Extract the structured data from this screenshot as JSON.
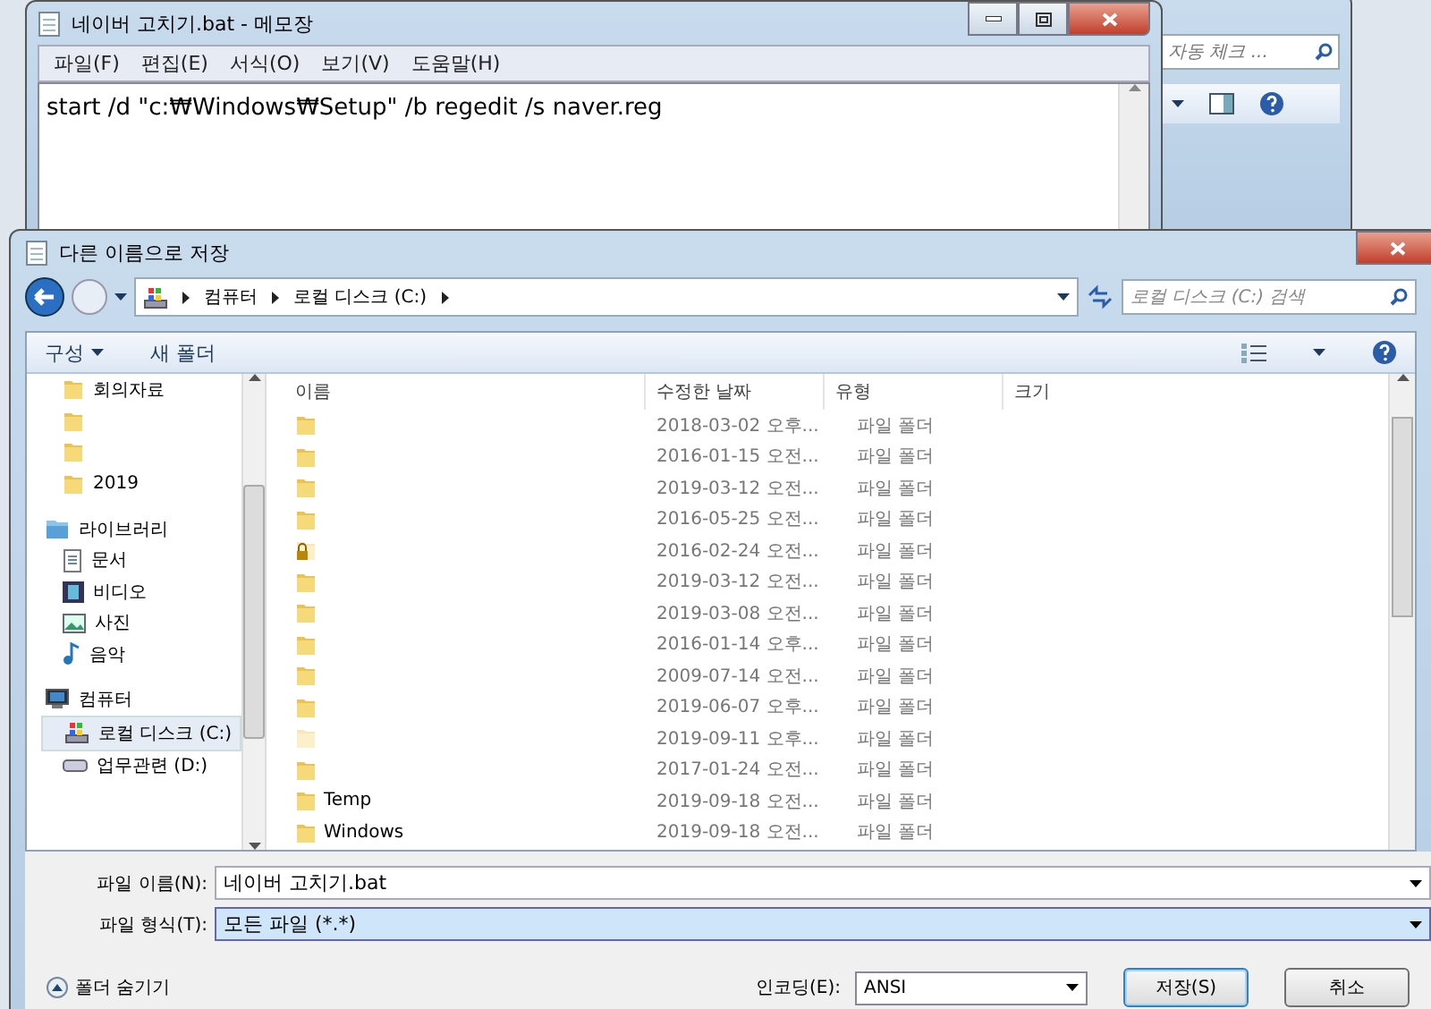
{
  "background_window": {
    "search": {
      "placeholder": "자동 체크 ..."
    }
  },
  "notepad": {
    "title": "네이버 고치기.bat - 메모장",
    "menu": [
      "파일(F)",
      "편집(E)",
      "서식(O)",
      "보기(V)",
      "도움말(H)"
    ],
    "text": "start /d \"c:₩Windows₩Setup\" /b regedit /s naver.reg"
  },
  "dialog": {
    "title": "다른 이름으로 저장",
    "breadcrumb": [
      "컴퓨터",
      "로컬 디스크 (C:)"
    ],
    "search": {
      "placeholder": "로컬 디스크 (C:) 검색"
    },
    "toolbar": {
      "organize": "구성",
      "new_folder": "새 폴더"
    },
    "nav": [
      {
        "kind": "folder",
        "label": "회의자료",
        "selected": false
      },
      {
        "kind": "folder",
        "selected": false
      },
      {
        "kind": "folder",
        "selected": false
      },
      {
        "kind": "folder",
        "label": "2019",
        "selected": false
      },
      {
        "kind": "library",
        "label": "라이브러리",
        "selected": false,
        "children": [
          {
            "kind": "document",
            "label": "문서",
            "selected": false
          },
          {
            "kind": "video",
            "label": "비디오",
            "selected": false
          },
          {
            "kind": "picture",
            "label": "사진",
            "selected": false
          },
          {
            "kind": "music",
            "label": "음악",
            "selected": false
          }
        ]
      },
      {
        "kind": "computer",
        "label": "컴퓨터",
        "selected": false,
        "children": [
          {
            "kind": "system-drive",
            "label": "로컬 디스크 (C:)",
            "selected": true
          },
          {
            "kind": "drive",
            "label": "업무관련 (D:)",
            "selected": false
          }
        ]
      }
    ],
    "columns": [
      "이름",
      "수정한 날짜",
      "유형",
      "크기"
    ],
    "rows": [
      {
        "kind": "folder",
        "date": "2018-03-02 오후...",
        "type": "파일 폴더"
      },
      {
        "kind": "folder",
        "date": "2016-01-15 오전...",
        "type": "파일 폴더"
      },
      {
        "kind": "folder",
        "date": "2019-03-12 오전...",
        "type": "파일 폴더"
      },
      {
        "kind": "folder",
        "date": "2016-05-25 오전...",
        "type": "파일 폴더"
      },
      {
        "kind": "locked",
        "date": "2016-02-24 오전...",
        "type": "파일 폴더"
      },
      {
        "kind": "folder",
        "date": "2019-03-12 오전...",
        "type": "파일 폴더"
      },
      {
        "kind": "folder",
        "date": "2019-03-08 오전...",
        "type": "파일 폴더"
      },
      {
        "kind": "folder",
        "date": "2016-01-14 오후...",
        "type": "파일 폴더"
      },
      {
        "kind": "folder",
        "date": "2009-07-14 오전...",
        "type": "파일 폴더"
      },
      {
        "kind": "folder",
        "date": "2019-06-07 오후...",
        "type": "파일 폴더"
      },
      {
        "kind": "hidden",
        "date": "2019-09-11 오후...",
        "type": "파일 폴더"
      },
      {
        "kind": "folder",
        "date": "2017-01-24 오전...",
        "type": "파일 폴더"
      },
      {
        "kind": "folder",
        "name": "Temp",
        "date": "2019-09-18 오전...",
        "type": "파일 폴더"
      },
      {
        "kind": "folder",
        "name": "Windows",
        "date": "2019-09-18 오전...",
        "type": "파일 폴더"
      }
    ],
    "file_name": {
      "label": "파일 이름(N):",
      "value": "네이버 고치기.bat"
    },
    "file_type": {
      "label": "파일 형식(T):",
      "value": "모든 파일 (*.*)"
    },
    "hide_folders": "폴더 숨기기",
    "encoding": {
      "label": "인코딩(E):",
      "value": "ANSI"
    },
    "buttons": [
      {
        "kind": "primary",
        "label": "저장(S)"
      },
      {
        "kind": "normal",
        "label": "취소"
      }
    ]
  }
}
